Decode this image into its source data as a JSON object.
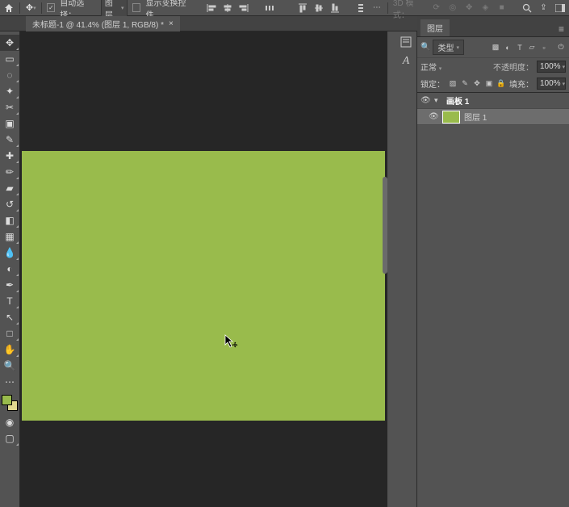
{
  "options_bar": {
    "auto_select_label": "自动选择：",
    "auto_select_checked": true,
    "target_dropdown": "图层",
    "show_transform_label": "显示变换控件",
    "show_transform_checked": false,
    "mode_3d_label": "3D 模式："
  },
  "tab": {
    "title": "未标题-1 @ 41.4% (图层 1, RGB/8) *",
    "close": "×"
  },
  "canvas": {
    "artboard_color": "#99bb4c"
  },
  "swatches": {
    "foreground": "#99bb4c",
    "background": "#e0d98f"
  },
  "panels": {
    "layers": {
      "tab_title": "图层",
      "filter_label": "类型",
      "blend_mode": "正常",
      "opacity_label": "不透明度：",
      "opacity_value": "100%",
      "lock_label": "锁定：",
      "fill_label": "填充：",
      "fill_value": "100%",
      "items": [
        {
          "name": "画板 1",
          "is_group": true,
          "selected": false
        },
        {
          "name": "图层 1",
          "is_group": false,
          "selected": true
        }
      ]
    }
  }
}
